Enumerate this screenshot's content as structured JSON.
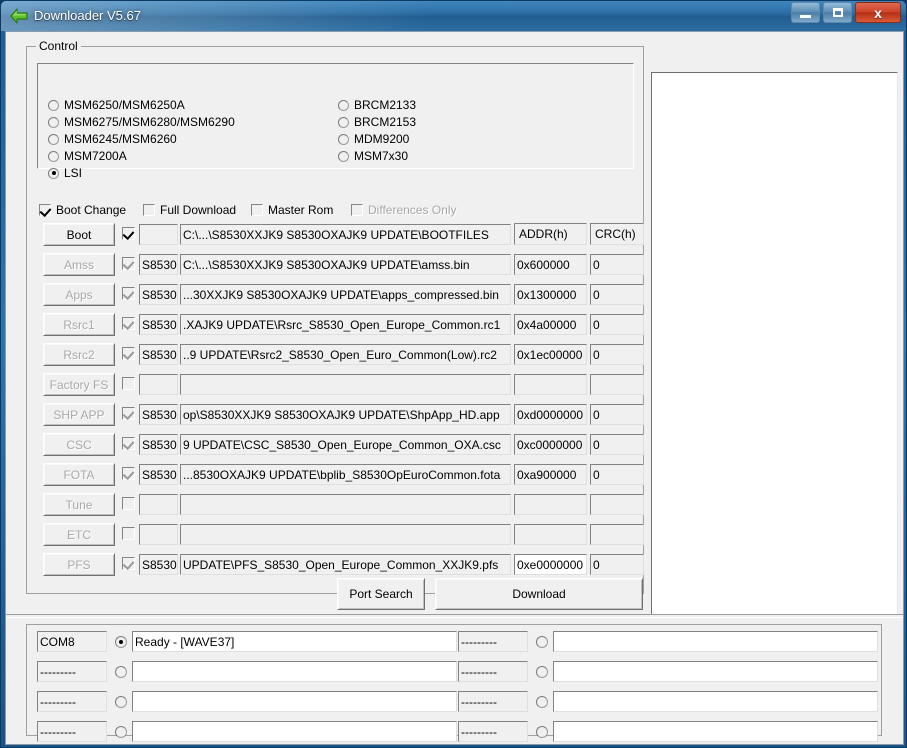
{
  "window": {
    "title": "Downloader V5.67",
    "back_icon": "back-arrow-icon",
    "minimize_label": "",
    "maximize_label": "",
    "close_label": "x"
  },
  "control_group": {
    "legend": "Control",
    "chipsets_left": [
      {
        "label": "MSM6250/MSM6250A",
        "selected": false
      },
      {
        "label": "MSM6275/MSM6280/MSM6290",
        "selected": false
      },
      {
        "label": "MSM6245/MSM6260",
        "selected": false
      },
      {
        "label": "MSM7200A",
        "selected": false
      },
      {
        "label": "LSI",
        "selected": true
      }
    ],
    "chipsets_right": [
      {
        "label": "BRCM2133",
        "selected": false
      },
      {
        "label": "BRCM2153",
        "selected": false
      },
      {
        "label": "MDM9200",
        "selected": false
      },
      {
        "label": "MSM7x30",
        "selected": false
      }
    ],
    "options": [
      {
        "label": "Boot Change",
        "checked": true,
        "enabled": true
      },
      {
        "label": "Full Download",
        "checked": false,
        "enabled": true
      },
      {
        "label": "Master Rom",
        "checked": false,
        "enabled": true
      },
      {
        "label": "Differences Only",
        "checked": false,
        "enabled": false
      }
    ],
    "columns": {
      "addr": "ADDR(h)",
      "crc": "CRC(h)"
    },
    "rows": [
      {
        "button": "Boot",
        "enabled": true,
        "checked": true,
        "check_gray": false,
        "model": "",
        "path": "C:\\...\\S8530XXJK9 S8530OXAJK9 UPDATE\\BOOTFILES",
        "addr": "",
        "crc": "",
        "addr_focus": false
      },
      {
        "button": "Amss",
        "enabled": false,
        "checked": true,
        "check_gray": true,
        "model": "S8530",
        "path": "C:\\...\\S8530XXJK9 S8530OXAJK9 UPDATE\\amss.bin",
        "addr": "0x600000",
        "crc": "0",
        "addr_focus": false
      },
      {
        "button": "Apps",
        "enabled": false,
        "checked": true,
        "check_gray": true,
        "model": "S8530",
        "path": "...30XXJK9 S8530OXAJK9 UPDATE\\apps_compressed.bin",
        "addr": "0x1300000",
        "crc": "0",
        "addr_focus": false
      },
      {
        "button": "Rsrc1",
        "enabled": false,
        "checked": true,
        "check_gray": true,
        "model": "S8530",
        "path": ".XAJK9 UPDATE\\Rsrc_S8530_Open_Europe_Common.rc1",
        "addr": "0x4a00000",
        "crc": "0",
        "addr_focus": false
      },
      {
        "button": "Rsrc2",
        "enabled": false,
        "checked": true,
        "check_gray": true,
        "model": "S8530",
        "path": "..9 UPDATE\\Rsrc2_S8530_Open_Euro_Common(Low).rc2",
        "addr": "0x1ec00000",
        "crc": "0",
        "addr_focus": false
      },
      {
        "button": "Factory FS",
        "enabled": false,
        "checked": false,
        "check_gray": false,
        "model": "",
        "path": "",
        "addr": "",
        "crc": "",
        "addr_focus": false
      },
      {
        "button": "SHP APP",
        "enabled": false,
        "checked": true,
        "check_gray": true,
        "model": "S8530",
        "path": "op\\S8530XXJK9 S8530OXAJK9 UPDATE\\ShpApp_HD.app",
        "addr": "0xd0000000",
        "crc": "0",
        "addr_focus": false
      },
      {
        "button": "CSC",
        "enabled": false,
        "checked": true,
        "check_gray": true,
        "model": "S8530",
        "path": "9 UPDATE\\CSC_S8530_Open_Europe_Common_OXA.csc",
        "addr": "0xc0000000",
        "crc": "0",
        "addr_focus": false
      },
      {
        "button": "FOTA",
        "enabled": false,
        "checked": true,
        "check_gray": true,
        "model": "S8530",
        "path": "...8530OXAJK9 UPDATE\\bplib_S8530OpEuroCommon.fota",
        "addr": "0xa900000",
        "crc": "0",
        "addr_focus": false
      },
      {
        "button": "Tune",
        "enabled": false,
        "checked": false,
        "check_gray": false,
        "model": "",
        "path": "",
        "addr": "",
        "crc": "",
        "addr_focus": false
      },
      {
        "button": "ETC",
        "enabled": false,
        "checked": false,
        "check_gray": false,
        "model": "",
        "path": "",
        "addr": "",
        "crc": "",
        "addr_focus": false
      },
      {
        "button": "PFS",
        "enabled": false,
        "checked": true,
        "check_gray": true,
        "model": "S8530",
        "path": "UPDATE\\PFS_S8530_Open_Europe_Common_XXJK9.pfs",
        "addr": "0xe0000000",
        "crc": "0",
        "addr_focus": true
      }
    ],
    "port_search_label": "Port Search",
    "download_label": "Download"
  },
  "log_panel": {
    "text": ""
  },
  "status_panel": {
    "ports_left": [
      {
        "port": "COM8",
        "selected": true,
        "message": "Ready - [WAVE37]"
      },
      {
        "port": "---------",
        "selected": false,
        "message": ""
      },
      {
        "port": "---------",
        "selected": false,
        "message": ""
      },
      {
        "port": "---------",
        "selected": false,
        "message": ""
      }
    ],
    "ports_right": [
      {
        "port": "---------",
        "selected": false,
        "message": ""
      },
      {
        "port": "---------",
        "selected": false,
        "message": ""
      },
      {
        "port": "---------",
        "selected": false,
        "message": ""
      },
      {
        "port": "---------",
        "selected": false,
        "message": ""
      }
    ]
  },
  "colors": {
    "title_bar": "#2b6fa5",
    "close_button": "#cc4226",
    "face": "#f0f0f0",
    "log_background": "#ffffff",
    "disabled_text": "#a8a8a8"
  }
}
